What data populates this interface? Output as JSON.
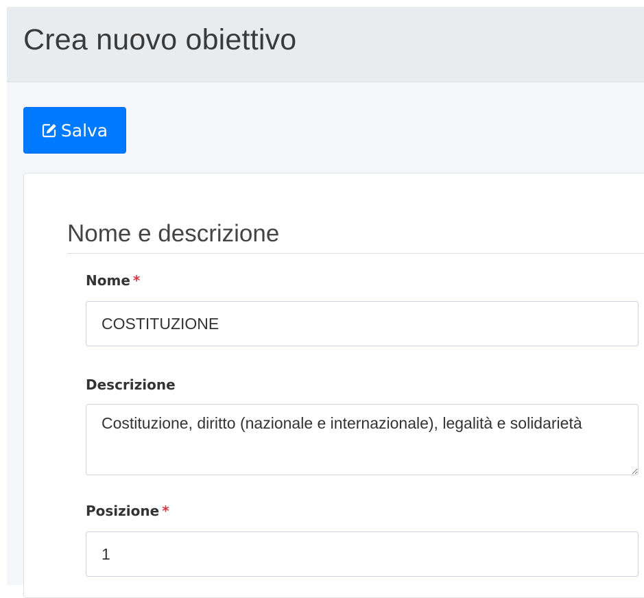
{
  "header": {
    "title": "Crea nuovo obiettivo"
  },
  "toolbar": {
    "save_label": "Salva",
    "save_icon": "edit-icon",
    "save_color": "#007bff"
  },
  "form": {
    "section_title": "Nome e descrizione",
    "required_marker": "*",
    "required_color": "#dc3545",
    "fields": {
      "nome": {
        "label": "Nome",
        "value": "COSTITUZIONE"
      },
      "descrizione": {
        "label": "Descrizione",
        "value": "Costituzione, diritto (nazionale e internazionale), legalità e solidarietà"
      },
      "posizione": {
        "label": "Posizione",
        "value": "1"
      }
    }
  }
}
